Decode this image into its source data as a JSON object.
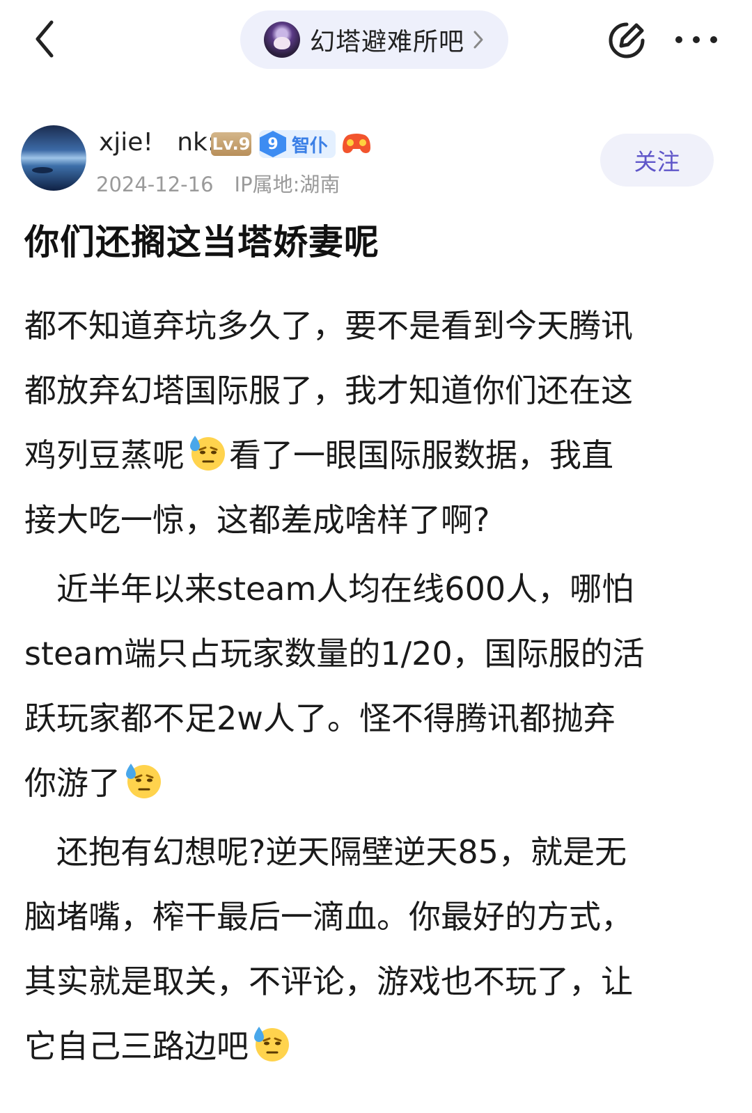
{
  "header": {
    "back_icon": "chevron-left-icon",
    "forum_name": "幻塔避难所吧",
    "edit_icon": "edit-icon",
    "more_icon": "more-dots-icon"
  },
  "author": {
    "name": "xjie!   nk:",
    "level": "Lv.9",
    "badge_number": "9",
    "badge_text": "智仆",
    "date": "2024-12-16",
    "ip": "IP属地:湖南",
    "follow_label": "关注"
  },
  "post": {
    "title": "你们还搁这当塔娇妻呢",
    "paragraphs": [
      {
        "lines": [
          "都不知道弃坑多久了，要不是看到今天腾讯",
          "都放弃幻塔国际服了，我才知道你们还在这",
          "鸡列豆蒸呢",
          "看了一眼国际服数据，我直",
          "接大吃一惊，这都差成啥样了啊?"
        ]
      },
      {
        "lines": [
          "　近半年以来steam人均在线600人，哪怕",
          "steam端只占玩家数量的1/20，国际服的活",
          "跃玩家都不足2w人了。怪不得腾讯都抛弃",
          "你游了"
        ]
      },
      {
        "lines": [
          "　还抱有幻想呢?逆天隔壁逆天85，就是无",
          "脑堵嘴，榨干最后一滴血。你最好的方式，",
          "其实就是取关，不评论，游戏也不玩了，让",
          "它自己三路边吧"
        ]
      }
    ],
    "emoji_icon": "sweat-emoji-icon"
  }
}
